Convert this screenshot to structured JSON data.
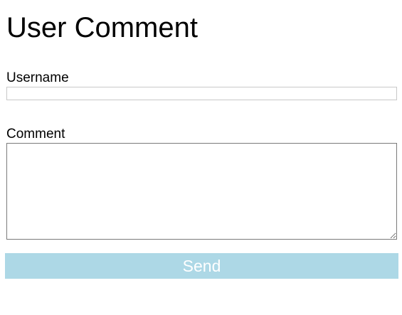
{
  "page": {
    "title": "User Comment"
  },
  "form": {
    "username": {
      "label": "Username",
      "value": "",
      "placeholder": ""
    },
    "comment": {
      "label": "Comment",
      "value": "",
      "placeholder": ""
    },
    "send_label": "Send"
  },
  "colors": {
    "button_background": "#add8e6",
    "button_text": "#ffffff",
    "username_border": "#c8c8c8",
    "comment_border": "#7a7a7a"
  }
}
